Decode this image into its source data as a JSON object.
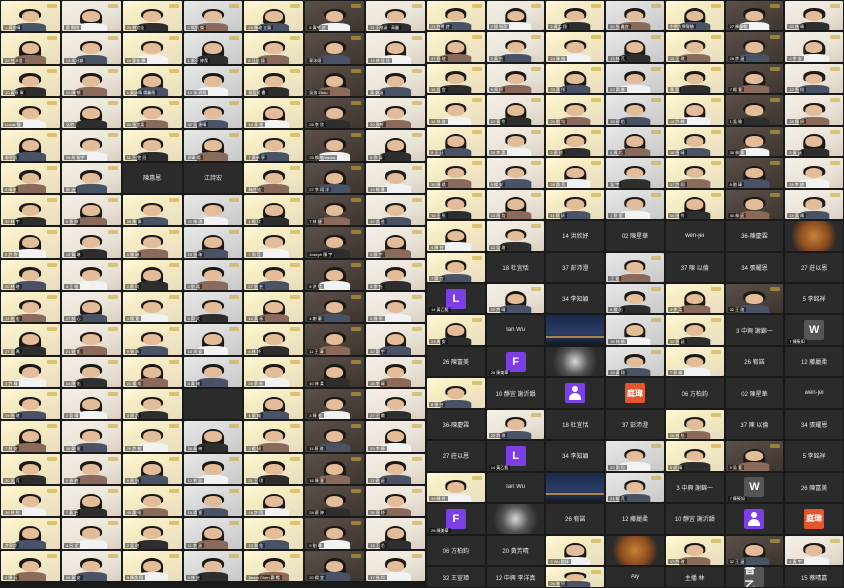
{
  "meeting": {
    "left_tiles": [
      {
        "kind": "video",
        "name": "1 黃稚晴"
      },
      {
        "kind": "video",
        "name": "鄭 顯翔"
      },
      {
        "kind": "video",
        "name": "24 林宜佳"
      },
      {
        "kind": "video",
        "name": "2 楊凱 傑"
      },
      {
        "kind": "video",
        "name": "20 陳政 立鳳"
      },
      {
        "kind": "video",
        "name": "8 黃芊 於"
      },
      {
        "kind": "video",
        "name": "11 王稚涵 · 高麗"
      },
      {
        "kind": "video",
        "name": "28 何沛澄"
      },
      {
        "kind": "video",
        "name": "13 吳冠穎"
      },
      {
        "kind": "video",
        "name": "19 鄭桂 縣"
      },
      {
        "kind": "video",
        "name": "1 廖芬 婷潔"
      },
      {
        "kind": "video",
        "name": "6 汪佳 錄"
      },
      {
        "kind": "video",
        "name": "郭沐翊"
      },
      {
        "kind": "video",
        "name": "13 林 佳 佳"
      },
      {
        "kind": "video",
        "name": "10 黃筱 寧"
      },
      {
        "kind": "video",
        "name": "12 陳 郁"
      },
      {
        "kind": "video",
        "name": "1 黃詠晴 楊麗薇"
      },
      {
        "kind": "video",
        "name": "10 張 玥翔"
      },
      {
        "kind": "video",
        "name": "蔡語萱 書"
      },
      {
        "kind": "video",
        "name": "吳洛 Zhou"
      },
      {
        "kind": "video",
        "name": "黃 穎涵"
      },
      {
        "kind": "video",
        "name": "Lucas 簡"
      },
      {
        "kind": "video",
        "name": "弘明"
      },
      {
        "kind": "video",
        "name": "01 張宜柔"
      },
      {
        "kind": "video",
        "name": "42 吳 婕晴"
      },
      {
        "kind": "video",
        "name": "18 蔣 逸"
      },
      {
        "kind": "video",
        "name": "26 李 欣"
      },
      {
        "kind": "video",
        "name": "20 張軒"
      },
      {
        "kind": "video",
        "name": "郭亭語"
      },
      {
        "kind": "video",
        "name": "26 胡 振宇"
      },
      {
        "kind": "video",
        "name": "11 王 雯 冠"
      },
      {
        "kind": "video",
        "name": "郭韋 揚"
      },
      {
        "kind": "video",
        "name": "7 黃卓 亭"
      },
      {
        "kind": "video",
        "name": "25 賴 敏Yanna"
      },
      {
        "kind": "video",
        "name": "5 徐 泰"
      },
      {
        "kind": "video",
        "name": "5 晴瑄"
      },
      {
        "kind": "video",
        "name": "郭 涵"
      },
      {
        "kind": "text",
        "name": "陳惠恩"
      },
      {
        "kind": "text",
        "name": "江詩宏"
      },
      {
        "kind": "video",
        "name": "林詩 宏"
      },
      {
        "kind": "video",
        "name": "27 李 翊 洋"
      },
      {
        "kind": "video",
        "name": "13 楊 雅"
      },
      {
        "kind": "video",
        "name": "32 林 宇"
      },
      {
        "kind": "video",
        "name": "5 張 婷"
      },
      {
        "kind": "video",
        "name": "28 陳 偉"
      },
      {
        "kind": "video",
        "name": "22 陳 琪"
      },
      {
        "kind": "video",
        "name": "1 楊 欣"
      },
      {
        "kind": "video",
        "name": "7 林 婕"
      },
      {
        "kind": "video",
        "name": "42 吳 芸"
      },
      {
        "kind": "video",
        "name": "9 許 伶"
      },
      {
        "kind": "video",
        "name": "19 黃 琳"
      },
      {
        "kind": "video",
        "name": "5 陳 珊"
      },
      {
        "kind": "video",
        "name": "15 張 琦"
      },
      {
        "kind": "video",
        "name": "7 周 哲"
      },
      {
        "kind": "video",
        "name": "Joseph 陳 宇"
      },
      {
        "kind": "video",
        "name": "9 郭 宇"
      },
      {
        "kind": "video",
        "name": "20 林 瑄"
      },
      {
        "kind": "video",
        "name": "4 王 彬"
      },
      {
        "kind": "video",
        "name": "2 蔡 均"
      },
      {
        "kind": "video",
        "name": "2 劉 嘉"
      },
      {
        "kind": "video",
        "name": "27 張 芸"
      },
      {
        "kind": "video",
        "name": "6 洪 恬"
      },
      {
        "kind": "video",
        "name": "8 李 怡"
      },
      {
        "kind": "video",
        "name": "14 施 宏"
      },
      {
        "kind": "video",
        "name": "27 林 心"
      },
      {
        "kind": "video",
        "name": "4 楊 萱"
      },
      {
        "kind": "video",
        "name": "6 鄭 文"
      },
      {
        "kind": "video",
        "name": "16 黃 禾"
      },
      {
        "kind": "video",
        "name": "4 謝 蓁"
      },
      {
        "kind": "video",
        "name": "5 陳 亭"
      },
      {
        "kind": "video",
        "name": "27 吳 珮"
      },
      {
        "kind": "video",
        "name": "21 劉 凱"
      },
      {
        "kind": "video",
        "name": "9 張 沛"
      },
      {
        "kind": "video",
        "name": "18 周 安"
      },
      {
        "kind": "video",
        "name": "4 林 妤"
      },
      {
        "kind": "video",
        "name": "11 王 澤"
      },
      {
        "kind": "video",
        "name": "22 鄭 宇"
      },
      {
        "kind": "video",
        "name": "3 許 樺"
      },
      {
        "kind": "video",
        "name": "14 陳 佑"
      },
      {
        "kind": "video",
        "name": "21 楊 翔"
      },
      {
        "kind": "video",
        "name": "4 黃 瑜"
      },
      {
        "kind": "video",
        "name": "25 蔡 依"
      },
      {
        "kind": "video",
        "name": "10 林 柔"
      },
      {
        "kind": "video",
        "name": "15 李 瑋"
      },
      {
        "kind": "video",
        "name": "19 張 瑄"
      },
      {
        "kind": "video",
        "name": "2 吳 晴"
      },
      {
        "kind": "video",
        "name": "3 周 芯"
      },
      {
        "kind": "text",
        "name": ""
      },
      {
        "kind": "video",
        "name": "1 郭 綸"
      },
      {
        "kind": "video",
        "name": "3 陳 宏"
      },
      {
        "kind": "video",
        "name": "27 王 嫻"
      },
      {
        "kind": "video",
        "name": "7 林 安"
      },
      {
        "kind": "video",
        "name": "16 鄭 萱"
      },
      {
        "kind": "video",
        "name": "20 許 祐"
      },
      {
        "kind": "video",
        "name": "26 黃 綺"
      },
      {
        "kind": "video",
        "name": "2 楊 妍"
      },
      {
        "kind": "video",
        "name": "11 蔡 瑄"
      },
      {
        "kind": "video",
        "name": "29 李 晴"
      },
      {
        "kind": "video",
        "name": "30 吳 芃"
      },
      {
        "kind": "video",
        "name": "6 張 綾"
      },
      {
        "kind": "video",
        "name": "8 周 愷"
      },
      {
        "kind": "video",
        "name": "12 劉 廷"
      },
      {
        "kind": "video",
        "name": "31 王 琪"
      },
      {
        "kind": "video",
        "name": "16 陳 萱"
      },
      {
        "kind": "video",
        "name": "11 郭 涵"
      },
      {
        "kind": "video",
        "name": "36 林 彤"
      },
      {
        "kind": "video",
        "name": "7 黃 芸"
      },
      {
        "kind": "video",
        "name": "40 鄭 暄"
      },
      {
        "kind": "video",
        "name": "15 楊 萱"
      },
      {
        "kind": "video",
        "name": "18 許 翔"
      },
      {
        "kind": "video",
        "name": "24 蔡 婷"
      },
      {
        "kind": "video",
        "name": "26 張 妤"
      },
      {
        "kind": "video",
        "name": "許家伶"
      },
      {
        "kind": "video",
        "name": "4 呂 文"
      },
      {
        "kind": "video",
        "name": "2 吳 瑄"
      },
      {
        "kind": "video",
        "name": "11 李 涵"
      },
      {
        "kind": "video",
        "name": "10 周 佑"
      },
      {
        "kind": "video",
        "name": "9 劉 琳"
      },
      {
        "kind": "video",
        "name": "13 王 芯"
      },
      {
        "kind": "video",
        "name": "2 陳 芳"
      },
      {
        "kind": "video",
        "name": "26 黃 安"
      },
      {
        "kind": "video",
        "name": "5 陳逸 翔"
      },
      {
        "kind": "video",
        "name": "8 林 芸"
      },
      {
        "kind": "video",
        "name": "Amon Chen 鄭 暢"
      },
      {
        "kind": "video",
        "name": "20 楊 宜"
      },
      {
        "kind": "video",
        "name": "17 張 均"
      },
      {
        "kind": "video",
        "name": "18 郭 安"
      },
      {
        "kind": "video",
        "name": "3 許 萱"
      },
      {
        "kind": "video",
        "name": "12 蔡 晴"
      },
      {
        "kind": "video",
        "name": "29 吳 涵"
      },
      {
        "kind": "video",
        "name": "15 周 瑄"
      },
      {
        "kind": "video",
        "name": "10 李 琪"
      },
      {
        "kind": "video",
        "name": "6 林 翔"
      },
      {
        "kind": "video",
        "name": "34 陳 宇"
      },
      {
        "kind": "video",
        "name": "6 黃 彤"
      },
      {
        "kind": "video",
        "name": "27 鄭 綾"
      },
      {
        "kind": "video",
        "name": "14 楊 妍"
      },
      {
        "kind": "video",
        "name": "31 王 伶"
      },
      {
        "kind": "video",
        "name": "27 許 愷"
      },
      {
        "kind": "video",
        "name": "22 蔡 廷"
      },
      {
        "kind": "video",
        "name": "4 吳 芃"
      },
      {
        "kind": "video",
        "name": "9 張 琪"
      },
      {
        "kind": "video",
        "name": "30 周 萱"
      },
      {
        "kind": "video",
        "name": "20 劉 芯"
      },
      {
        "kind": "video",
        "name": "3 李 瑜"
      },
      {
        "kind": "video",
        "name": "13 林 柔"
      },
      {
        "kind": "video",
        "name": "1 陳 瑋"
      }
    ],
    "right_tiles": [
      {
        "kind": "video",
        "name": "23 許菁 詩"
      },
      {
        "kind": "video",
        "name": "2 楊 珮潔"
      },
      {
        "kind": "video",
        "name": "5 黃孟 翔"
      },
      {
        "kind": "video",
        "name": "32 張 鑫宜"
      },
      {
        "kind": "video",
        "name": "中興大學實驗"
      },
      {
        "kind": "video",
        "name": "27 陳慶翰"
      },
      {
        "kind": "video",
        "name": "35 林 晴"
      },
      {
        "kind": "video",
        "name": "37 郭 瑄"
      },
      {
        "kind": "video",
        "name": "2 黃 芸"
      },
      {
        "kind": "video",
        "name": "24 陳 愷"
      },
      {
        "kind": "video",
        "name": "13 林 芃"
      },
      {
        "kind": "video",
        "name": "15 王 琪"
      },
      {
        "kind": "video",
        "name": "28 許 涵"
      },
      {
        "kind": "video",
        "name": "9 李 安"
      },
      {
        "kind": "video",
        "name": "16 吳 宜"
      },
      {
        "kind": "video",
        "name": "6 周 妤"
      },
      {
        "kind": "video",
        "name": "33 蔡 彤"
      },
      {
        "kind": "video",
        "name": "22 鄭 琳"
      },
      {
        "kind": "video",
        "name": "陳 惠"
      },
      {
        "kind": "video",
        "name": "7 楊 萱"
      },
      {
        "kind": "video",
        "name": "12 張 翔"
      },
      {
        "kind": "video",
        "name": "34 林 瑄"
      },
      {
        "kind": "video",
        "name": "12 黃 伶"
      },
      {
        "kind": "video",
        "name": "20 劉 均"
      },
      {
        "kind": "video",
        "name": "15 郭 佑"
      },
      {
        "kind": "video",
        "name": "18 許 綺"
      },
      {
        "kind": "video",
        "name": "1 吳 瑜"
      },
      {
        "kind": "video",
        "name": "28 陳 妍"
      },
      {
        "kind": "video",
        "name": "9 王 廷"
      },
      {
        "kind": "video",
        "name": "25 李 柔"
      },
      {
        "kind": "video",
        "name": "2 蔡 瑄"
      },
      {
        "kind": "video",
        "name": "4 周 芯"
      },
      {
        "kind": "video",
        "name": "16 張 晴"
      },
      {
        "kind": "video",
        "name": "35 林 萱"
      },
      {
        "kind": "video",
        "name": "5 黃 涵"
      },
      {
        "kind": "video",
        "name": "36 陳 琪"
      },
      {
        "kind": "video",
        "name": "5 楊 安"
      },
      {
        "kind": "video",
        "name": "28 鄭 芃"
      },
      {
        "kind": "video",
        "name": "吳 宇"
      },
      {
        "kind": "video",
        "name": "17 許 翔"
      },
      {
        "kind": "video",
        "name": "8 劉 瑋"
      },
      {
        "kind": "video",
        "name": "28 李 綾"
      },
      {
        "kind": "video",
        "name": "10 王 彤"
      },
      {
        "kind": "video",
        "name": "13 周 均"
      },
      {
        "kind": "video",
        "name": "11 郭 妍"
      },
      {
        "kind": "video",
        "name": "1 蔡 萱"
      },
      {
        "kind": "video",
        "name": "10 張 伶"
      },
      {
        "kind": "video",
        "name": "40 林 廷"
      },
      {
        "kind": "video",
        "name": "14 黃 晴"
      },
      {
        "kind": "video",
        "name": "4 陳 芸"
      },
      {
        "kind": "video",
        "name": "12 吳 瑄"
      },
      {
        "kind": "text",
        "name": "14 洪欣妤"
      },
      {
        "kind": "text",
        "name": "02 陳星華"
      },
      {
        "kind": "text",
        "name": "wen-jei"
      },
      {
        "kind": "text",
        "name": "36-陳慶霖"
      },
      {
        "kind": "food",
        "name": ""
      },
      {
        "kind": "video",
        "name": "7 鄭 宜"
      },
      {
        "kind": "text",
        "name": "18 杜宜恬"
      },
      {
        "kind": "text",
        "name": "37 彭沛澄"
      },
      {
        "kind": "video",
        "name": "王 萱"
      },
      {
        "kind": "text",
        "name": "37 陳 以倫"
      },
      {
        "kind": "text",
        "name": "34 張耀恩"
      },
      {
        "kind": "text",
        "name": "27 莊以恩"
      },
      {
        "kind": "avatar",
        "color": "purple",
        "letter": "L",
        "name": "14 黃乙甄"
      },
      {
        "kind": "video",
        "name": "22 許 晴"
      },
      {
        "kind": "text",
        "name": "34 李知穎"
      },
      {
        "kind": "video",
        "name": "6 楊 佑"
      },
      {
        "kind": "video",
        "name": "4 李 柔"
      },
      {
        "kind": "video",
        "name": "32 王 瑄"
      },
      {
        "kind": "text",
        "name": "5 李銘祥"
      },
      {
        "kind": "video",
        "name": "23 周 安"
      },
      {
        "kind": "text",
        "name": "Ian Wu"
      },
      {
        "kind": "sky",
        "name": ""
      },
      {
        "kind": "video",
        "name": "16 林 綺"
      },
      {
        "kind": "video",
        "name": "12 蔡 涵"
      },
      {
        "kind": "text",
        "name": "3 中興 謝錦一"
      },
      {
        "kind": "avatar",
        "color": "gray",
        "letter": "W",
        "name": "7 陳筱如"
      },
      {
        "kind": "text",
        "name": "26 陳富美"
      },
      {
        "kind": "avatar",
        "color": "purple",
        "letter": "F",
        "name": "28 陳美華"
      },
      {
        "kind": "robot",
        "name": ""
      },
      {
        "kind": "video",
        "name": "19 黃 翔"
      },
      {
        "kind": "video",
        "name": "7 郭 瑜"
      },
      {
        "kind": "text",
        "name": "26 宥諾"
      },
      {
        "kind": "text",
        "name": "12 藤麗柔"
      },
      {
        "kind": "video",
        "name": "8 張 芸"
      },
      {
        "kind": "text",
        "name": "10 靜宜 謝沂韻"
      },
      {
        "kind": "person",
        "name": ""
      },
      {
        "kind": "avatar",
        "color": "orange",
        "letter": "庭瑋",
        "name": ""
      },
      {
        "kind": "text",
        "name": "06 方柏鈞"
      },
      {
        "kind": "text",
        "name": "02 陳星華"
      },
      {
        "kind": "text",
        "name": "wen-jei"
      },
      {
        "kind": "text",
        "name": "36-陳慶霖"
      },
      {
        "kind": "video",
        "name": "23 許 琪"
      },
      {
        "kind": "text",
        "name": "18 杜宜恬"
      },
      {
        "kind": "text",
        "name": "37 彭沛澄"
      },
      {
        "kind": "video",
        "name": "28 林 彤"
      },
      {
        "kind": "text",
        "name": "37 陳 以倫"
      },
      {
        "kind": "text",
        "name": "34 張耀恩"
      },
      {
        "kind": "text",
        "name": "27 莊以恩"
      },
      {
        "kind": "avatar",
        "color": "purple",
        "letter": "L",
        "name": "14 黃乙甄"
      },
      {
        "kind": "text",
        "name": "34 李知穎"
      },
      {
        "kind": "video",
        "name": "22 鄭 均"
      },
      {
        "kind": "video",
        "name": "5 周 晴"
      },
      {
        "kind": "video",
        "name": "9 吳 萱"
      },
      {
        "kind": "text",
        "name": "5 李銘祥"
      },
      {
        "kind": "video",
        "name": "33 陳 伶"
      },
      {
        "kind": "text",
        "name": "Ian Wu"
      },
      {
        "kind": "sky",
        "name": ""
      },
      {
        "kind": "video",
        "name": "21 楊 芃"
      },
      {
        "kind": "text",
        "name": "3 中興 謝錦一"
      },
      {
        "kind": "avatar",
        "color": "gray",
        "letter": "W",
        "name": "7 陳筱如"
      },
      {
        "kind": "text",
        "name": "26 陳富美"
      },
      {
        "kind": "avatar",
        "color": "purple",
        "letter": "F",
        "name": "28 陳美華"
      },
      {
        "kind": "robot",
        "name": ""
      },
      {
        "kind": "text",
        "name": "26 宥諾"
      },
      {
        "kind": "text",
        "name": "12 藤麗柔"
      },
      {
        "kind": "text",
        "name": "10 靜宜 謝沂韻"
      },
      {
        "kind": "person",
        "name": ""
      },
      {
        "kind": "avatar",
        "color": "orange",
        "letter": "庭瑋",
        "name": ""
      },
      {
        "kind": "text",
        "name": "06 方柏鈞"
      },
      {
        "kind": "text",
        "name": "20 黃芳晴"
      },
      {
        "kind": "video",
        "name": "5 Wu 翻譯"
      },
      {
        "kind": "food",
        "name": ""
      },
      {
        "kind": "video",
        "name": "17 許 瑄"
      },
      {
        "kind": "video",
        "name": "32 王 涵"
      },
      {
        "kind": "video",
        "name": "4 黃 宇"
      },
      {
        "kind": "text",
        "name": "32 王宣璋"
      },
      {
        "kind": "text",
        "name": "12 中興 李洋真"
      },
      {
        "kind": "video",
        "name": "26 林 妍"
      },
      {
        "kind": "text",
        "name": "Aiy"
      },
      {
        "kind": "text",
        "name": "主播 林"
      },
      {
        "kind": "avatar",
        "color": "gray",
        "letter": "普乙",
        "name": ""
      },
      {
        "kind": "text",
        "name": "15 蔡晴嘉"
      }
    ]
  }
}
